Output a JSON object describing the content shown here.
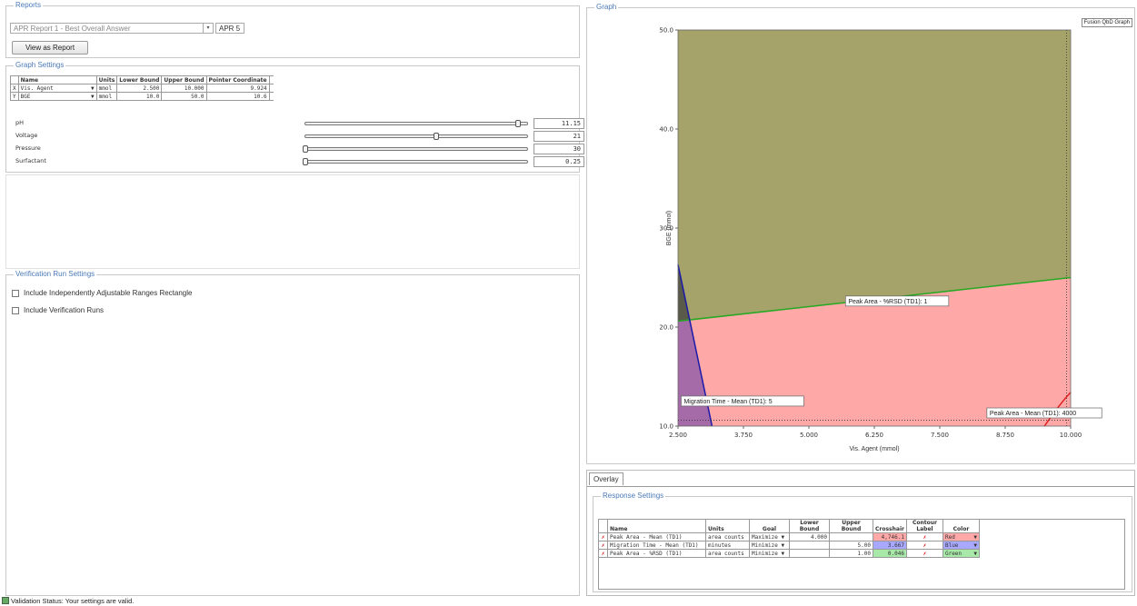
{
  "reports": {
    "legend": "Reports",
    "report_select": "APR Report 1 - Best Overall Answer",
    "report_code": "APR 5",
    "view_button": "View as Report"
  },
  "graph_settings": {
    "legend": "Graph Settings",
    "headers": [
      "Name",
      "Units",
      "Lower Bound",
      "Upper Bound",
      "Pointer Coordinate"
    ],
    "rows": [
      {
        "axis": "X",
        "name": "Vis. Agent",
        "units": "mmol",
        "lower": "2.500",
        "upper": "10.000",
        "pointer": "9.924"
      },
      {
        "axis": "Y",
        "name": "BGE",
        "units": "mmol",
        "lower": "10.0",
        "upper": "50.0",
        "pointer": "10.6"
      }
    ],
    "sliders": [
      {
        "label": "pH",
        "value": "11.15",
        "level": 0.96
      },
      {
        "label": "Voltage",
        "value": "21",
        "level": 0.59
      },
      {
        "label": "Pressure",
        "value": "30",
        "level": 0.0
      },
      {
        "label": "Surfactant",
        "value": "0.25",
        "level": 0.0
      }
    ]
  },
  "verification": {
    "legend": "Verification Run Settings",
    "option1": "Include Independently Adjustable Ranges Rectangle",
    "option2": "Include Verification Runs"
  },
  "graph": {
    "legend": "Graph",
    "badge": "Fusion QbD Graph",
    "ylabel": "BGE (mmol)",
    "xlabel": "Vis. Agent (mmol)",
    "xticks": [
      "2.500",
      "3.750",
      "5.000",
      "6.250",
      "7.500",
      "8.750",
      "10.000"
    ],
    "yticks": [
      "10.0",
      "20.0",
      "30.0",
      "40.0",
      "50.0"
    ],
    "label_rsd": "Peak Area - %RSD (TD1): 1",
    "label_mig": "Migration Time - Mean (TD1): 5",
    "label_mean": "Peak Area - Mean (TD1): 4000"
  },
  "overlay": {
    "tab": "Overlay",
    "legend": "Response Settings",
    "headers": [
      "Name",
      "Units",
      "Goal",
      "Lower Bound",
      "Upper Bound",
      "Crosshair",
      "Contour Label",
      "Color"
    ],
    "rows": [
      {
        "name": "Peak Area - Mean (TD1)",
        "units": "area counts",
        "goal": "Maximize",
        "lower": "4.000",
        "upper": "",
        "cross": "4,746.1",
        "color": "Red"
      },
      {
        "name": "Migration Time - Mean (TD1)",
        "units": "minutes",
        "goal": "Minimize",
        "lower": "",
        "upper": "5.00",
        "cross": "3.667",
        "color": "Blue"
      },
      {
        "name": "Peak Area - %RSD (TD1)",
        "units": "area counts",
        "goal": "Minimize",
        "lower": "",
        "upper": "1.00",
        "cross": "0.046",
        "color": "Green"
      }
    ]
  },
  "status": "Validation Status: Your settings are valid.",
  "colors": {
    "olive": "#a6a36a",
    "pink": "#ffa8a8",
    "purple": "#a56aa8",
    "green": "#22aa22",
    "blue": "#1a1aaa",
    "red": "#e02020",
    "legend_blue": "#4a7ab8"
  },
  "chart_data": {
    "type": "area",
    "xlabel": "Vis. Agent (mmol)",
    "ylabel": "BGE (mmol)",
    "xlim": [
      2.5,
      10.0
    ],
    "ylim": [
      10.0,
      50.0
    ],
    "series": [
      {
        "name": "Peak Area - %RSD (TD1): 1",
        "x": [
          2.5,
          10.0
        ],
        "y": [
          20.6,
          25.0
        ]
      },
      {
        "name": "Migration Time - Mean (TD1): 5",
        "x": [
          2.5,
          3.15
        ],
        "y": [
          26.3,
          10.0
        ]
      },
      {
        "name": "Peak Area - Mean (TD1): 4000",
        "x": [
          9.5,
          10.0
        ],
        "y": [
          10.0,
          13.4
        ]
      }
    ],
    "crosshair": {
      "x": 9.924,
      "y": 10.6
    }
  }
}
